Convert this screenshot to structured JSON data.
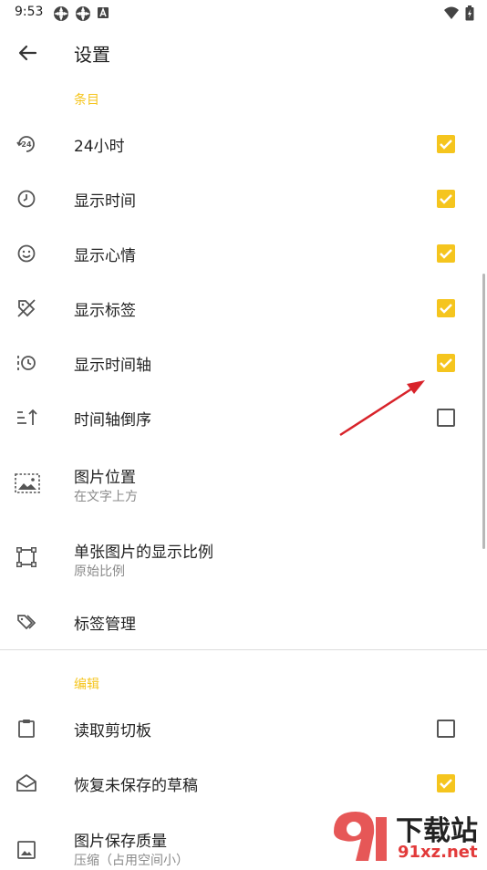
{
  "status": {
    "time": "9:53"
  },
  "app_bar": {
    "title": "设置"
  },
  "sections": {
    "items_header": "条目",
    "edit_header": "编辑"
  },
  "rows": {
    "r24h": {
      "title": "24小时",
      "checked": true
    },
    "show_time": {
      "title": "显示时间",
      "checked": true
    },
    "show_mood": {
      "title": "显示心情",
      "checked": true
    },
    "show_tags": {
      "title": "显示标签",
      "checked": true
    },
    "show_timeline": {
      "title": "显示时间轴",
      "checked": true
    },
    "timeline_reverse": {
      "title": "时间轴倒序",
      "checked": false
    },
    "image_position": {
      "title": "图片位置",
      "subtitle": "在文字上方"
    },
    "single_image_ratio": {
      "title": "单张图片的显示比例",
      "subtitle": "原始比例"
    },
    "tag_manage": {
      "title": "标签管理"
    },
    "read_clipboard": {
      "title": "读取剪切板",
      "checked": false
    },
    "restore_draft": {
      "title": "恢复未保存的草稿",
      "checked": true
    },
    "image_quality": {
      "title": "图片保存质量",
      "subtitle": "压缩（占用空间小）"
    }
  },
  "watermark": {
    "brand": "下载站",
    "domain": "91xz.net"
  },
  "colors": {
    "accent": "#f5c51e",
    "text": "#222222",
    "subtext": "#8a8a8a",
    "arrow": "#d8232a"
  }
}
